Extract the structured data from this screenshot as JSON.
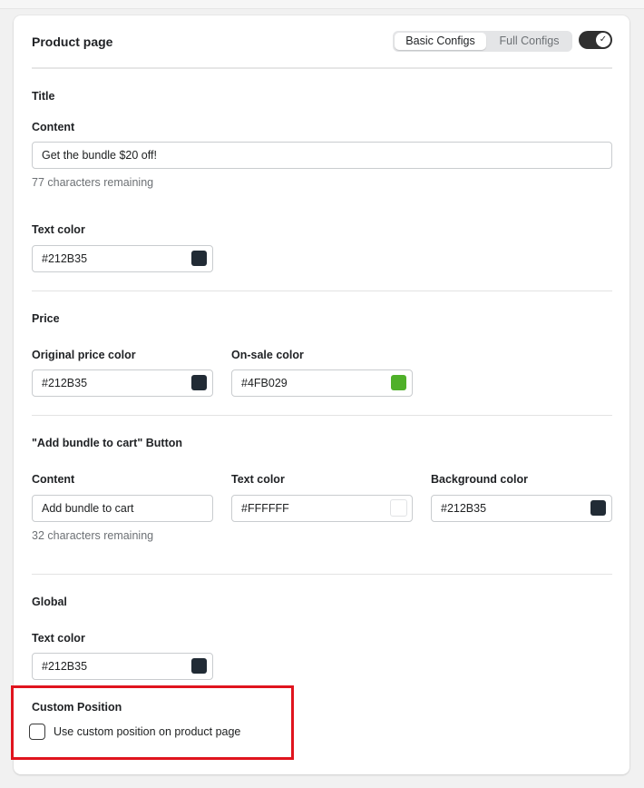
{
  "header": {
    "title": "Product page",
    "config_tabs": [
      "Basic Configs",
      "Full Configs"
    ],
    "active_tab": "Basic Configs",
    "toggle_on": true
  },
  "title_section": {
    "heading": "Title",
    "content_label": "Content",
    "content_value": "Get the bundle $20 off!",
    "content_help": "77 characters remaining",
    "text_color_label": "Text color",
    "text_color_value": "#212B35"
  },
  "price_section": {
    "heading": "Price",
    "original_label": "Original price color",
    "original_value": "#212B35",
    "onsale_label": "On-sale color",
    "onsale_value": "#4FB029"
  },
  "button_section": {
    "heading": "\"Add bundle to cart\" Button",
    "content_label": "Content",
    "content_value": "Add bundle to cart",
    "content_help": "32 characters remaining",
    "text_color_label": "Text color",
    "text_color_value": "#FFFFFF",
    "bg_color_label": "Background color",
    "bg_color_value": "#212B35"
  },
  "global_section": {
    "heading": "Global",
    "text_color_label": "Text color",
    "text_color_value": "#212B35"
  },
  "custom_position": {
    "heading": "Custom Position",
    "checkbox_label": "Use custom position on product page",
    "checked": false
  },
  "colors": {
    "dark": "#212B35",
    "green": "#4FB029",
    "white": "#FFFFFF",
    "highlight": "#E0141E"
  }
}
